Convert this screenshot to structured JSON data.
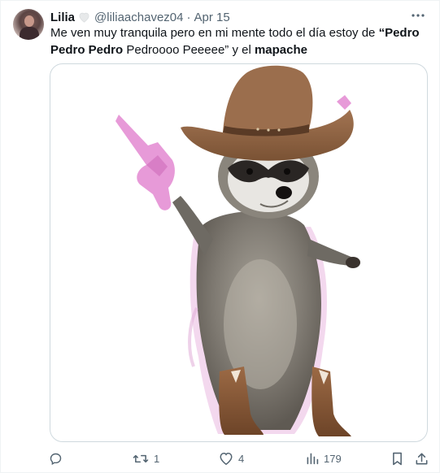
{
  "tweet": {
    "display_name": "Lilia",
    "handle": "@liliaachavez04",
    "separator": "·",
    "date": "Apr 15",
    "text_parts": {
      "p1": "Me ven muy tranquila pero en mi mente todo el día estoy de ",
      "p2": "“Pedro Pedro Pedro",
      "p3": " Pedroooo Peeeee” y el ",
      "p4": "mapache"
    }
  },
  "actions": {
    "reply_count": "",
    "retweet_count": "1",
    "like_count": "4",
    "views_count": "179"
  },
  "icons": [
    "verified-heart-icon",
    "more-icon",
    "reply-icon",
    "retweet-icon",
    "like-icon",
    "views-icon",
    "bookmark-icon",
    "share-icon"
  ],
  "colors": {
    "text": "#0f1419",
    "secondary": "#536471",
    "border": "#cfd9de"
  }
}
